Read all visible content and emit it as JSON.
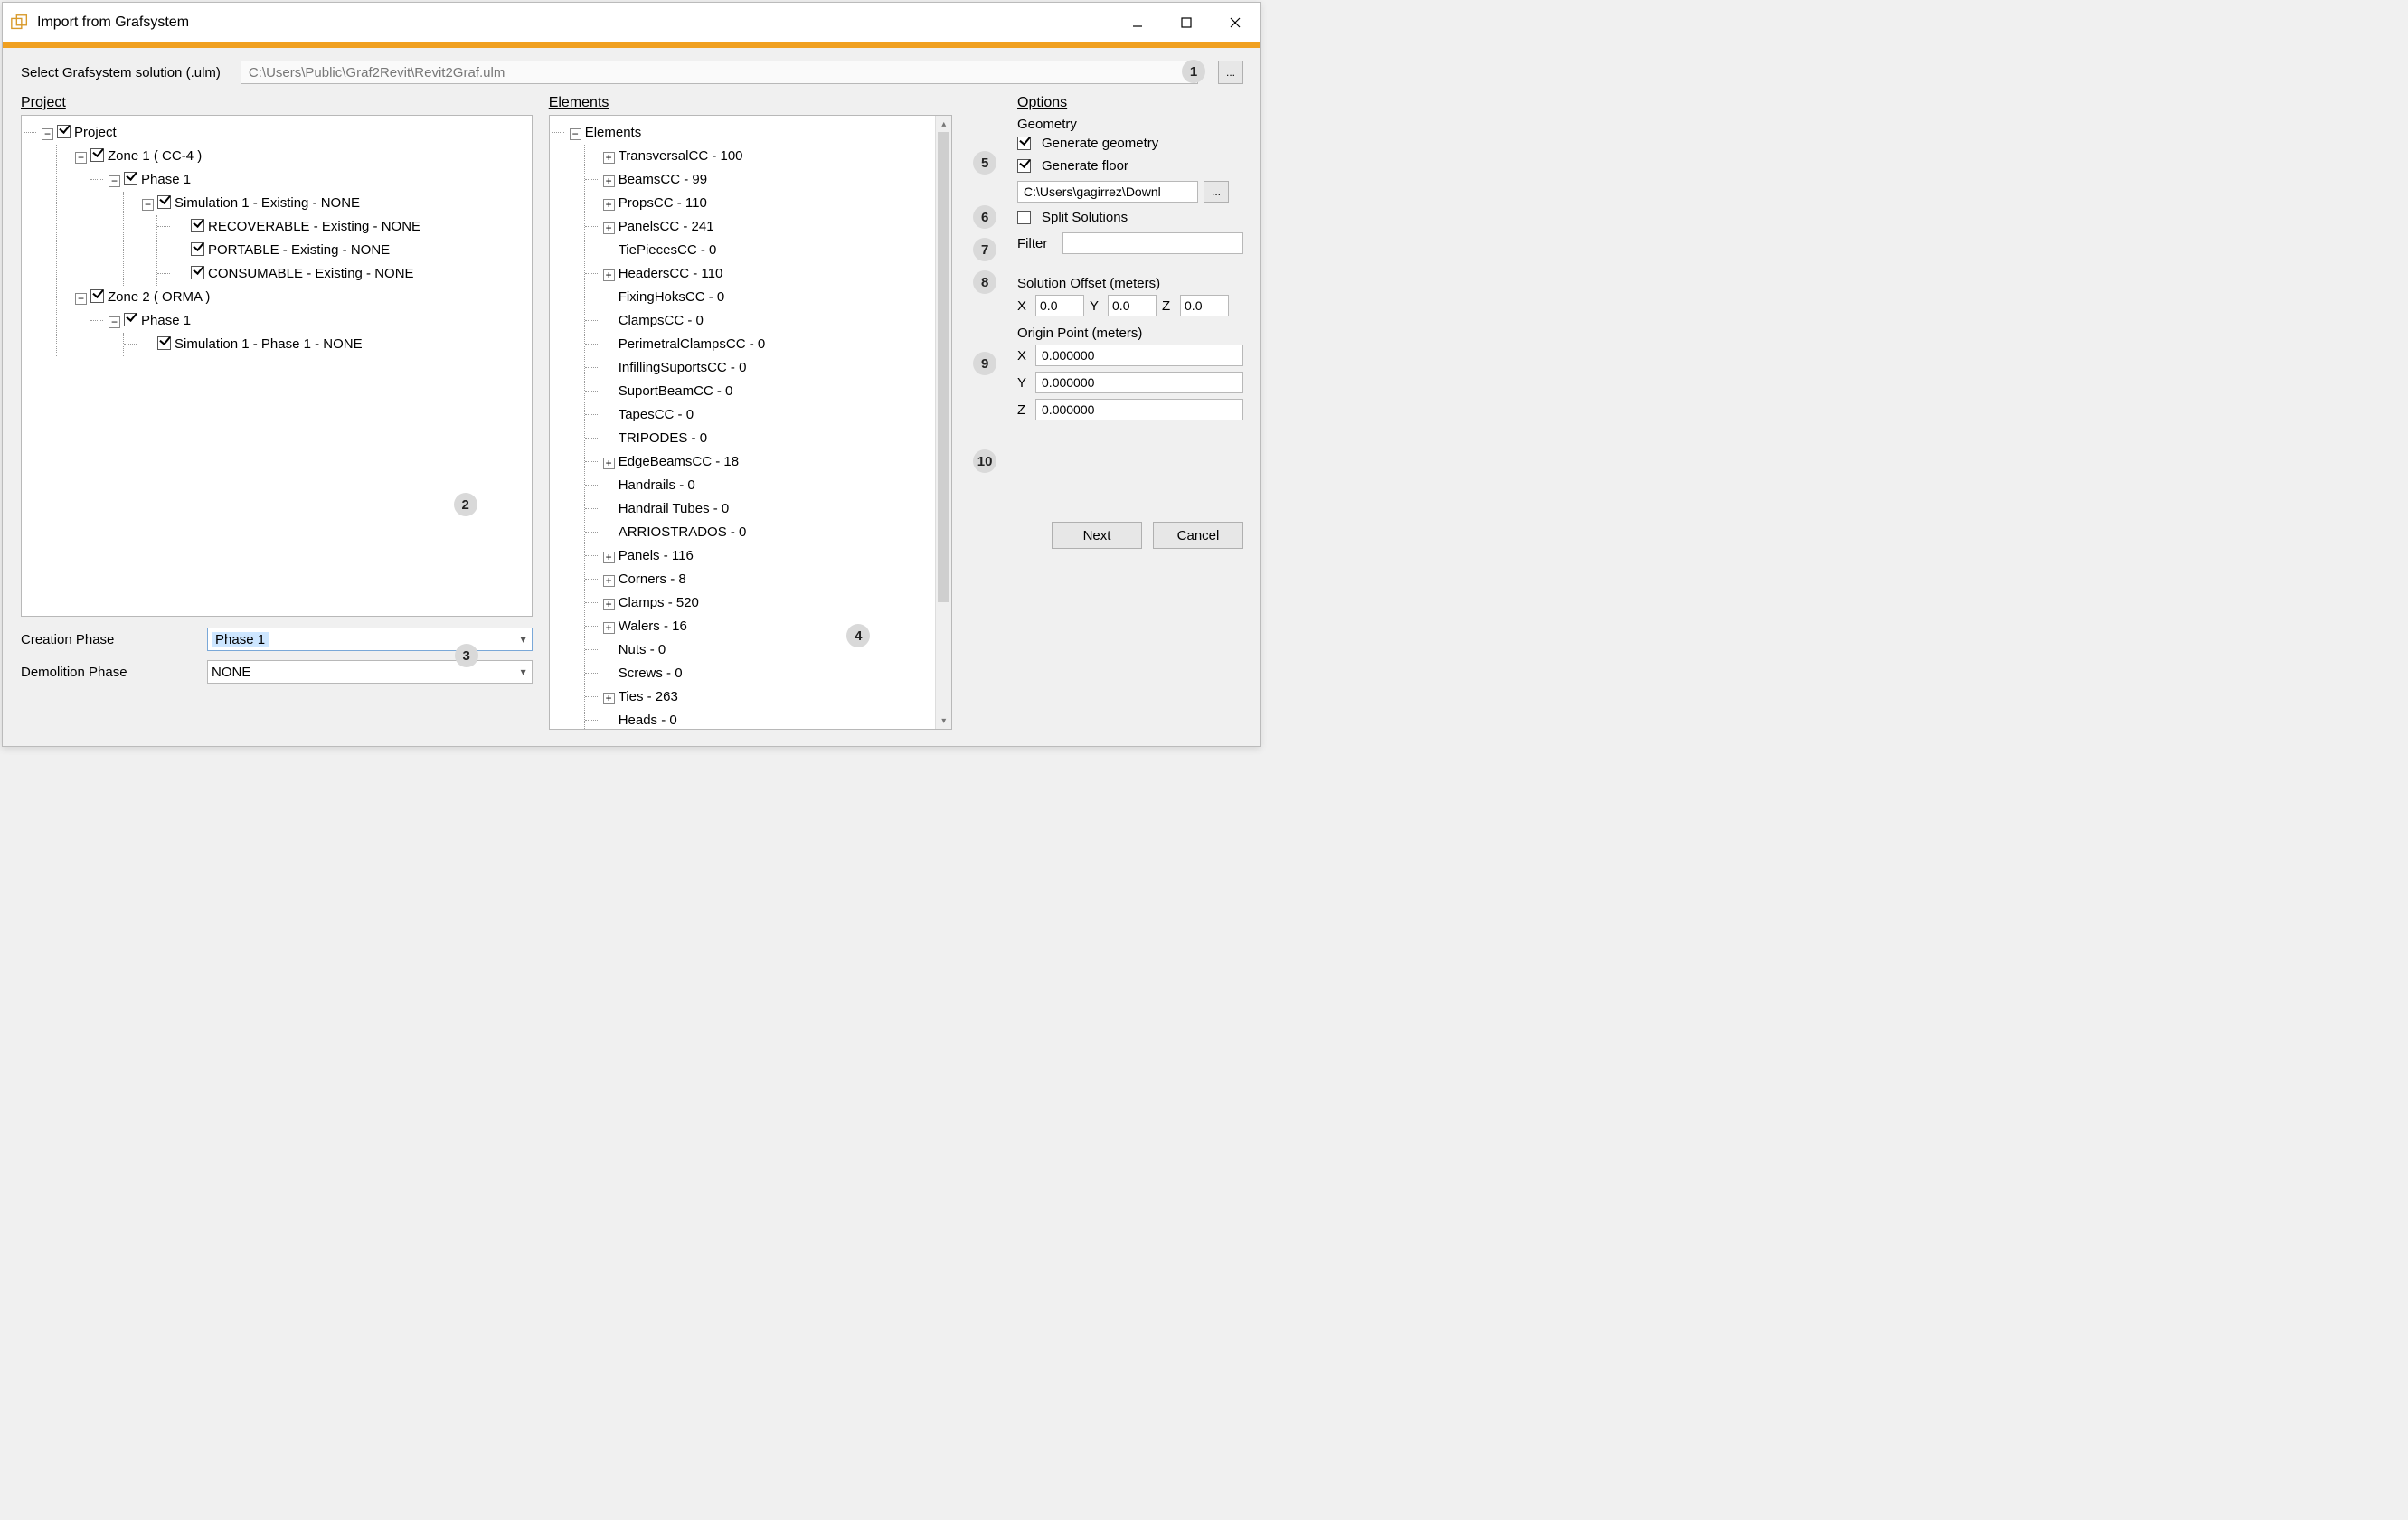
{
  "window": {
    "title": "Import from Grafsystem"
  },
  "file": {
    "label": "Select Grafsystem solution (.ulm)",
    "path": "C:\\Users\\Public\\Graf2Revit\\Revit2Graf.ulm",
    "browse": "..."
  },
  "sections": {
    "project": "Project",
    "elements": "Elements",
    "options": "Options"
  },
  "projectTree": [
    {
      "label": "Project",
      "expanded": true,
      "checked": true,
      "children": [
        {
          "label": "Zone 1 ( CC-4 )",
          "expanded": true,
          "checked": true,
          "children": [
            {
              "label": "Phase 1",
              "expanded": true,
              "checked": true,
              "children": [
                {
                  "label": "Simulation 1 - Existing - NONE",
                  "expanded": true,
                  "checked": true,
                  "children": [
                    {
                      "label": "RECOVERABLE  - Existing - NONE",
                      "checked": true
                    },
                    {
                      "label": "PORTABLE  - Existing - NONE",
                      "checked": true
                    },
                    {
                      "label": "CONSUMABLE  - Existing - NONE",
                      "checked": true
                    }
                  ]
                }
              ]
            }
          ]
        },
        {
          "label": "Zone 2 ( ORMA )",
          "expanded": true,
          "checked": true,
          "children": [
            {
              "label": "Phase 1",
              "expanded": true,
              "checked": true,
              "children": [
                {
                  "label": "Simulation 1 - Phase 1 - NONE",
                  "checked": true
                }
              ]
            }
          ]
        }
      ]
    }
  ],
  "phases": {
    "creationLabel": "Creation Phase",
    "creationValue": "Phase 1",
    "demolitionLabel": "Demolition Phase",
    "demolitionValue": "NONE"
  },
  "elementsTree": [
    {
      "label": "Elements",
      "expanded": true,
      "children": [
        {
          "label": "TransversalCC - 100",
          "toggle": "expand"
        },
        {
          "label": "BeamsCC - 99",
          "toggle": "expand"
        },
        {
          "label": "PropsCC - 110",
          "toggle": "expand"
        },
        {
          "label": "PanelsCC - 241",
          "toggle": "expand"
        },
        {
          "label": "TiePiecesCC - 0"
        },
        {
          "label": "HeadersCC - 110",
          "toggle": "expand"
        },
        {
          "label": "FixingHoksCC - 0"
        },
        {
          "label": "ClampsCC - 0"
        },
        {
          "label": "PerimetralClampsCC - 0"
        },
        {
          "label": "InfillingSuportsCC - 0"
        },
        {
          "label": "SuportBeamCC - 0"
        },
        {
          "label": "TapesCC - 0"
        },
        {
          "label": "TRIPODES - 0"
        },
        {
          "label": "EdgeBeamsCC - 18",
          "toggle": "expand"
        },
        {
          "label": "Handrails - 0"
        },
        {
          "label": "Handrail Tubes - 0"
        },
        {
          "label": "ARRIOSTRADOS - 0"
        },
        {
          "label": "Panels - 116",
          "toggle": "expand"
        },
        {
          "label": "Corners - 8",
          "toggle": "expand"
        },
        {
          "label": "Clamps - 520",
          "toggle": "expand"
        },
        {
          "label": "Walers - 16",
          "toggle": "expand"
        },
        {
          "label": "Nuts - 0"
        },
        {
          "label": "Screws - 0"
        },
        {
          "label": "Ties - 263",
          "toggle": "expand"
        },
        {
          "label": "Heads - 0"
        }
      ]
    }
  ],
  "options": {
    "geometryLabel": "Geometry",
    "genGeometry": "Generate geometry",
    "genFloor": "Generate floor",
    "floorPath": "C:\\Users\\gagirrez\\Downl",
    "split": "Split Solutions",
    "filterLabel": "Filter",
    "filterValue": "",
    "solutionOffset": "Solution Offset (meters)",
    "offset": {
      "x": "0.0",
      "y": "0.0",
      "z": "0.0"
    },
    "originPoint": "Origin Point (meters)",
    "origin": {
      "x": "0.000000",
      "y": "0.000000",
      "z": "0.000000"
    }
  },
  "buttons": {
    "next": "Next",
    "cancel": "Cancel",
    "browse": "..."
  },
  "callouts": {
    "1": "1",
    "2": "2",
    "3": "3",
    "4": "4",
    "5": "5",
    "6": "6",
    "7": "7",
    "8": "8",
    "9": "9",
    "10": "10"
  },
  "axis": {
    "x": "X",
    "y": "Y",
    "z": "Z"
  }
}
